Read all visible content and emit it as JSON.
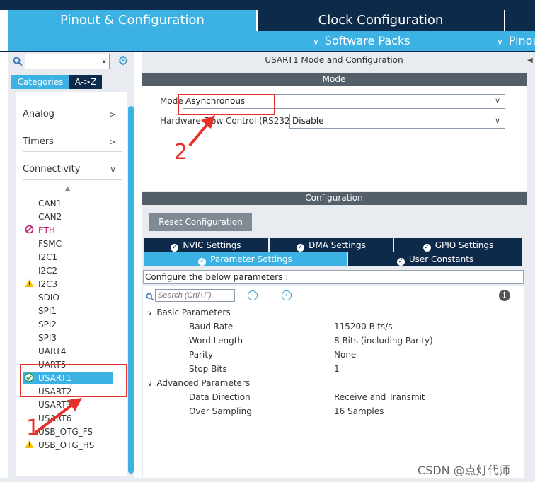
{
  "tabs": {
    "pinout": "Pinout & Configuration",
    "clock": "Clock Configuration"
  },
  "subbar": {
    "software_packs": "Software Packs",
    "pinout": "Pinou"
  },
  "left": {
    "categories_tab": "Categories",
    "az_tab": "A->Z",
    "groups": {
      "analog": "Analog",
      "timers": "Timers",
      "connectivity": "Connectivity"
    },
    "peripherals": [
      "CAN1",
      "CAN2",
      "ETH",
      "FSMC",
      "I2C1",
      "I2C2",
      "I2C3",
      "SDIO",
      "SPI1",
      "SPI2",
      "SPI3",
      "UART4",
      "UART5",
      "USART1",
      "USART2",
      "USART3",
      "USART6",
      "USB_OTG_FS",
      "USB_OTG_HS"
    ]
  },
  "mode_panel": {
    "title": "USART1 Mode and Configuration",
    "mode_header": "Mode",
    "mode_label": "Mode",
    "mode_value": "Asynchronous",
    "hw_flow_label": "Hardware Flow Control (RS232)",
    "hw_flow_value": "Disable"
  },
  "config_panel": {
    "header": "Configuration",
    "reset_button": "Reset Configuration",
    "tabs": {
      "nvic": "NVIC Settings",
      "dma": "DMA Settings",
      "gpio": "GPIO Settings",
      "parameter": "Parameter Settings",
      "user_constants": "User Constants"
    },
    "help_text": "Configure the below parameters :",
    "search_placeholder": "Search (Crtl+F)",
    "basic_header": "Basic Parameters",
    "basic": [
      {
        "name": "Baud Rate",
        "value": "115200 Bits/s"
      },
      {
        "name": "Word Length",
        "value": "8 Bits (including Parity)"
      },
      {
        "name": "Parity",
        "value": "None"
      },
      {
        "name": "Stop Bits",
        "value": "1"
      }
    ],
    "advanced_header": "Advanced Parameters",
    "advanced": [
      {
        "name": "Data Direction",
        "value": "Receive and Transmit"
      },
      {
        "name": "Over Sampling",
        "value": "16 Samples"
      }
    ]
  },
  "annotations": {
    "step1": "1",
    "step2": "2"
  },
  "watermark": "CSDN @点灯代师",
  "colors": {
    "accent": "#3bb2e3",
    "dark": "#0e2a4a",
    "annotation": "#e8302b",
    "warning": "#f2c200",
    "error": "#c0186b",
    "ok": "#2e9e4f"
  }
}
